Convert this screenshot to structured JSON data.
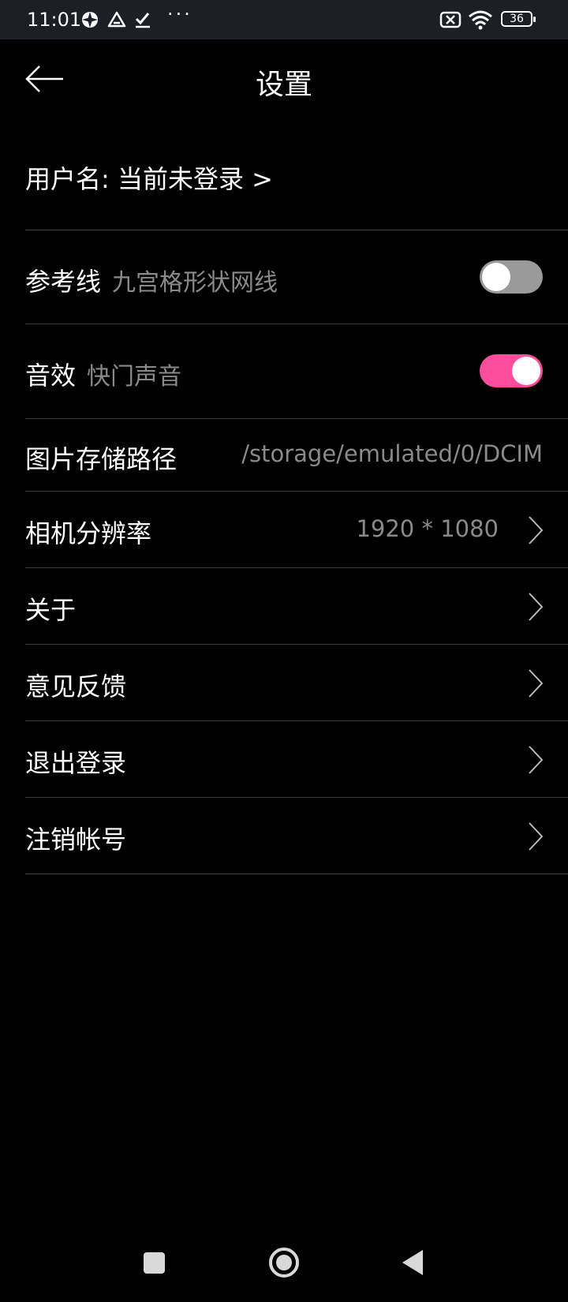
{
  "status_bar": {
    "time": "11:01",
    "battery": "36",
    "icons": [
      "vpn-icon",
      "drive-icon",
      "check-icon",
      "more-dots-icon",
      "no-sim-icon",
      "wifi-icon",
      "battery-icon"
    ],
    "dots": "···"
  },
  "header": {
    "title": "设置",
    "back_icon": "arrow-left-icon"
  },
  "settings": {
    "username": "用户名: 当前未登录 >",
    "grid": {
      "label": "参考线",
      "sub": "九宫格形状网线",
      "enabled": false
    },
    "sound": {
      "label": "音效",
      "sub": "快门声音",
      "enabled": true
    },
    "storage": {
      "label": "图片存储路径",
      "value": "/storage/emulated/0/DCIM"
    },
    "resolution": {
      "label": "相机分辨率",
      "value": "1920 * 1080"
    },
    "about": {
      "label": "关于"
    },
    "feedback": {
      "label": "意见反馈"
    },
    "logout": {
      "label": "退出登录"
    },
    "delete_account": {
      "label": "注销帐号"
    }
  },
  "colors": {
    "accent": "#ff4d9d",
    "toggle_off": "#9a9a9a",
    "divider": "#3a3a3a",
    "muted_text": "#8a8a8a"
  }
}
